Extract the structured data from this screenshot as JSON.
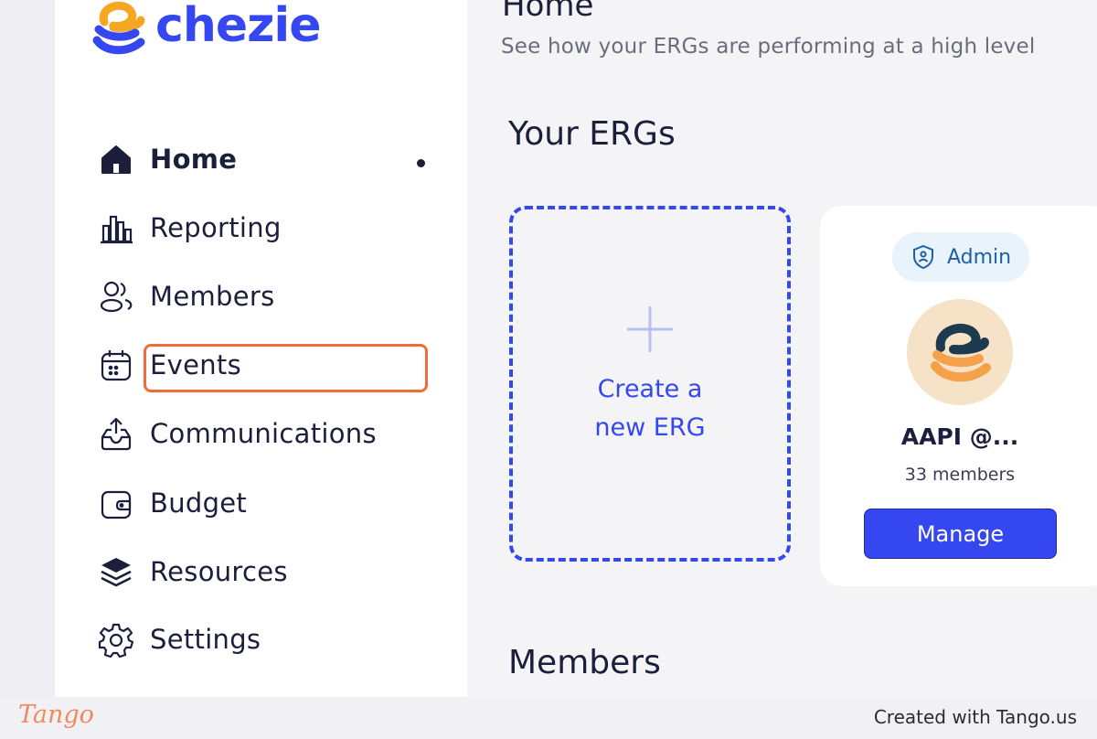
{
  "app": {
    "logo_text": "chezie",
    "brand_color": "#3447f0"
  },
  "sidebar": {
    "items": [
      {
        "label": "Home",
        "icon": "home-icon",
        "active": true
      },
      {
        "label": "Reporting",
        "icon": "bar-chart-icon"
      },
      {
        "label": "Members",
        "icon": "users-icon"
      },
      {
        "label": "Events",
        "icon": "calendar-icon",
        "highlighted": true
      },
      {
        "label": "Communications",
        "icon": "outbox-icon"
      },
      {
        "label": "Budget",
        "icon": "wallet-icon"
      },
      {
        "label": "Resources",
        "icon": "layers-icon"
      },
      {
        "label": "Settings",
        "icon": "gear-icon"
      }
    ]
  },
  "main": {
    "title": "Home",
    "subtitle": "See how your ERGs are performing at a high level",
    "ergs_section_title": "Your ERGs",
    "create_card": {
      "line1": "Create a",
      "line2": "new ERG",
      "icon": "plus-icon"
    },
    "erg_card": {
      "badge": "Admin",
      "badge_icon": "shield-icon",
      "name": "AAPI @...",
      "members": "33 members",
      "button": "Manage"
    },
    "members_section_title": "Members"
  },
  "footer": {
    "tango_logo": "Tango",
    "credit": "Created with Tango.us",
    "highlight_color": "#f26b3a"
  }
}
